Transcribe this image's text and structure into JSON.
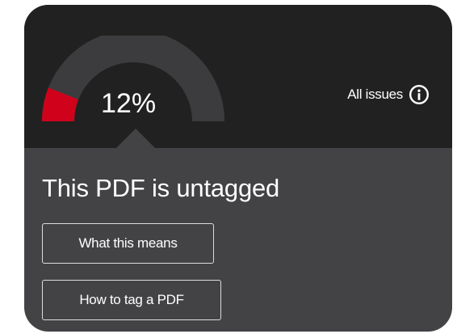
{
  "score": {
    "percent_label": "12%",
    "value": 0.12,
    "fill_color": "#d0021b",
    "track_color": "#3c3c3f"
  },
  "all_issues": {
    "label": "All issues",
    "icon": "info-circle-icon"
  },
  "status": {
    "title": "This PDF is untagged"
  },
  "buttons": {
    "what_this_means": "What this means",
    "how_to_tag": "How to tag a PDF"
  }
}
